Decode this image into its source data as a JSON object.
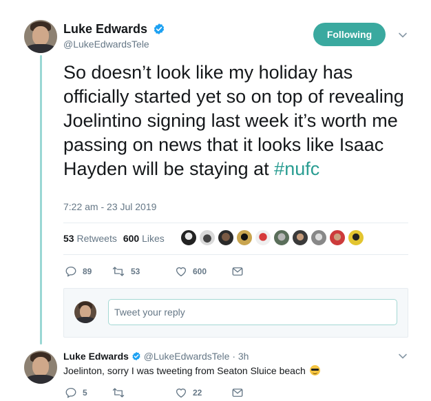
{
  "main_tweet": {
    "author_name": "Luke Edwards",
    "author_handle": "@LukeEdwardsTele",
    "follow_label": "Following",
    "text": "So doesn’t look like my holiday has officially started yet so on top of revealing Joelintino signing last week it’s worth me passing on news that it looks like Isaac Hayden will be staying at ",
    "hashtag": "#nufc",
    "timestamp": "7:22 am - 23 Jul 2019",
    "retweets_count": "53",
    "retweets_label": "Retweets",
    "likes_count": "600",
    "likes_label": "Likes",
    "actions": {
      "replies": "89",
      "retweets": "53",
      "likes": "600"
    }
  },
  "reply_box": {
    "placeholder": "Tweet your reply"
  },
  "reply_tweet": {
    "author_name": "Luke Edwards",
    "author_handle": "@LukeEdwardsTele",
    "separator": "·",
    "time": "3h",
    "text": "Joelinton, sorry I was tweeting from Seaton Sluice beach",
    "actions": {
      "replies": "5",
      "retweets": "",
      "likes": "22"
    }
  },
  "colors": {
    "accent": "#3aa99f",
    "thread_line": "#9ad7d4",
    "verified": "#1da1f2",
    "muted": "#657786"
  }
}
